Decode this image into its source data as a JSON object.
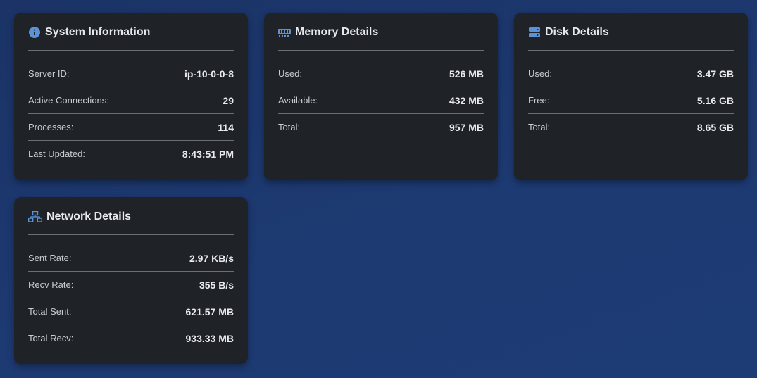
{
  "colors": {
    "background": "#1c3770",
    "card": "#1f2226",
    "accent": "#5b93d9"
  },
  "system": {
    "icon": "info-icon",
    "title": "System Information",
    "rows": [
      {
        "label": "Server ID:",
        "value": "ip-10-0-0-8"
      },
      {
        "label": "Active Connections:",
        "value": "29"
      },
      {
        "label": "Processes:",
        "value": "114"
      },
      {
        "label": "Last Updated:",
        "value": "8:43:51 PM"
      }
    ]
  },
  "memory": {
    "icon": "memory-icon",
    "title": "Memory Details",
    "rows": [
      {
        "label": "Used:",
        "value": "526 MB"
      },
      {
        "label": "Available:",
        "value": "432 MB"
      },
      {
        "label": "Total:",
        "value": "957 MB"
      }
    ]
  },
  "disk": {
    "icon": "hard-drive-icon",
    "title": "Disk Details",
    "rows": [
      {
        "label": "Used:",
        "value": "3.47 GB"
      },
      {
        "label": "Free:",
        "value": "5.16 GB"
      },
      {
        "label": "Total:",
        "value": "8.65 GB"
      }
    ]
  },
  "network": {
    "icon": "network-icon",
    "title": "Network Details",
    "rows": [
      {
        "label": "Sent Rate:",
        "value": "2.97 KB/s"
      },
      {
        "label": "Recv Rate:",
        "value": "355 B/s"
      },
      {
        "label": "Total Sent:",
        "value": "621.57 MB"
      },
      {
        "label": "Total Recv:",
        "value": "933.33 MB"
      }
    ]
  }
}
